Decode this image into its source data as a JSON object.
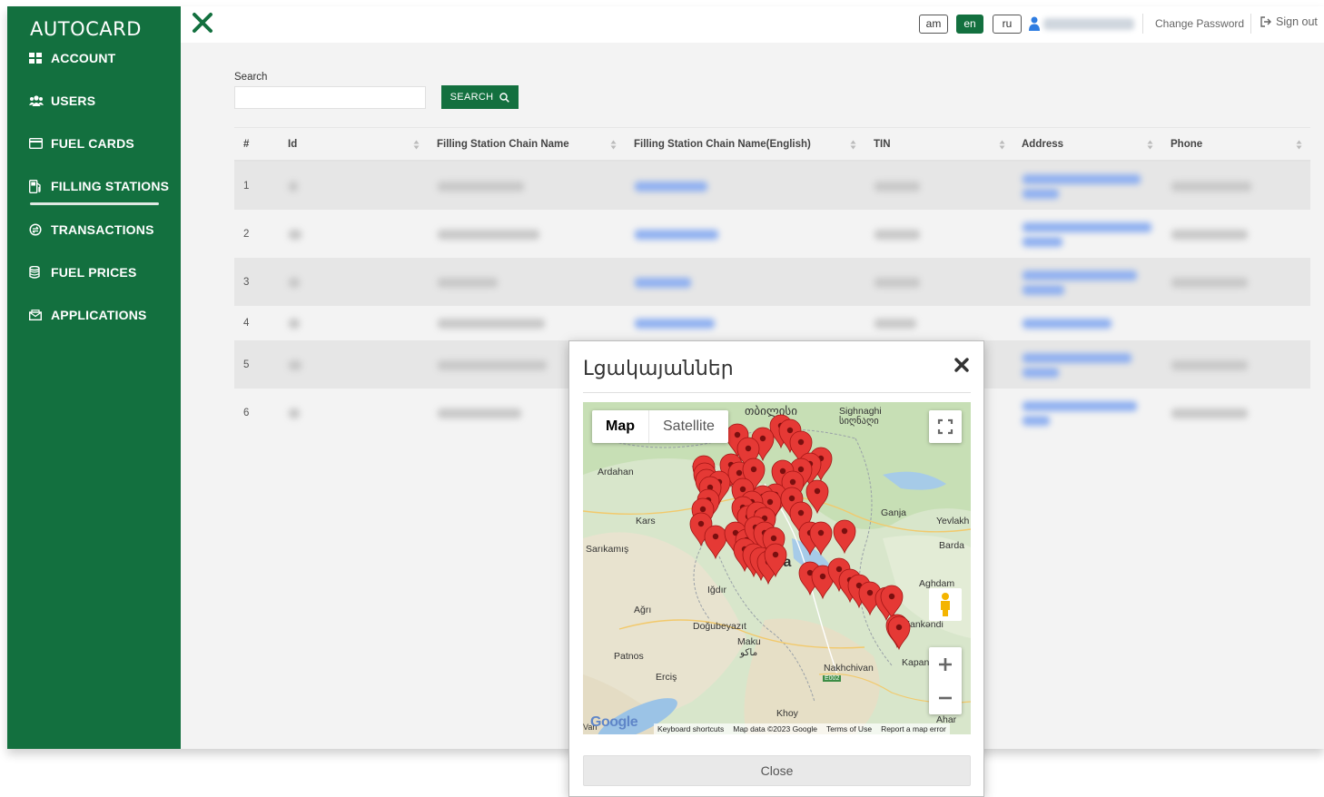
{
  "brand": {
    "logo": "AUTOCARD",
    "accent": "#13703f"
  },
  "sidebar": {
    "items": [
      {
        "label": "ACCOUNT",
        "icon": "grid-icon"
      },
      {
        "label": "USERS",
        "icon": "users-icon"
      },
      {
        "label": "FUEL CARDS",
        "icon": "card-icon"
      },
      {
        "label": "FILLING STATIONS",
        "icon": "fuel-pump-icon",
        "active": true
      },
      {
        "label": "TRANSACTIONS",
        "icon": "transactions-icon"
      },
      {
        "label": "FUEL PRICES",
        "icon": "database-icon"
      },
      {
        "label": "APPLICATIONS",
        "icon": "applications-icon"
      }
    ]
  },
  "topbar": {
    "languages": [
      "am",
      "en",
      "ru"
    ],
    "active_language": "en",
    "change_password": "Change Password",
    "sign_out": "Sign out"
  },
  "search": {
    "label": "Search",
    "value": "",
    "button": "SEARCH"
  },
  "table": {
    "columns": [
      "#",
      "Id",
      "Filling Station Chain Name",
      "Filling Station Chain Name(English)",
      "TIN",
      "Address",
      "Phone"
    ],
    "rows": [
      "1",
      "2",
      "3",
      "4",
      "5",
      "6"
    ]
  },
  "modal": {
    "title": "Լցակայաններ",
    "close_label": "Close",
    "map": {
      "type_options": [
        "Map",
        "Satellite"
      ],
      "selected_type": "Map",
      "labels": [
        "თბილისი",
        "Sighnaghi",
        "სიღნაღი",
        "Ardahan",
        "Kars",
        "Ganja",
        "Yevlakh",
        "Barda",
        "Sarıkamış",
        "ia",
        "Aghdam",
        "Iğdır",
        "Ağrı",
        "Doğubeyazıt",
        "Maku",
        "ماکو",
        "Xankəndi",
        "Kapan",
        "Patnos",
        "Erciş",
        "Nakhchivan",
        "E002",
        "Khoy",
        "Ahar",
        "Van"
      ],
      "attribution": [
        "Keyboard shortcuts",
        "Map data ©2023 Google",
        "Terms of Use",
        "Report a map error"
      ],
      "logo": "Google",
      "marker_color": "#e53935"
    }
  }
}
